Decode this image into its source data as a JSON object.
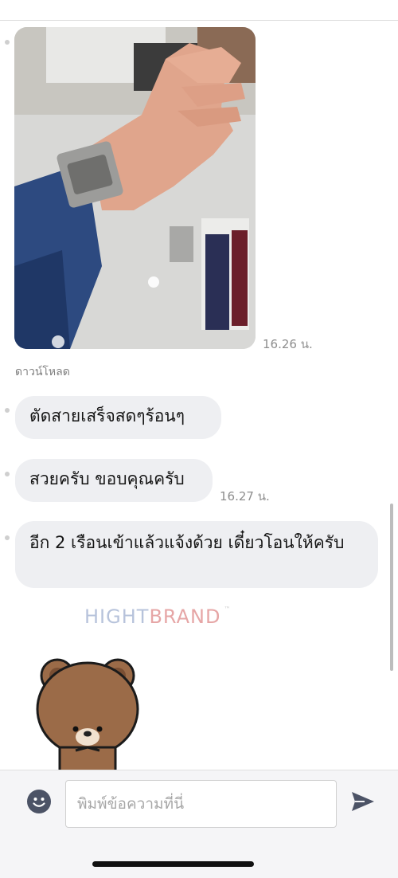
{
  "chat": {
    "photo": {
      "alt": "watch-photo"
    },
    "photo_time": "16.26 น.",
    "download_label": "ดาวน์โหลด",
    "messages": [
      {
        "text": "ตัดสายเสร็จสดๆร้อนๆ"
      },
      {
        "text": "สวยครับ ขอบคุณครับ",
        "time": "16.27 น."
      },
      {
        "text": "อีก 2 เรือนเข้าแล้วแจ้งด้วย เดี๋ยวโอนให้ครับ"
      }
    ],
    "sticker": {
      "brand_part1": "HIGHT",
      "brand_part2": "BRAND",
      "tm": "™"
    }
  },
  "composer": {
    "placeholder": "พิมพ์ข้อความที่นี่",
    "emoji_icon": "emoji-icon",
    "send_icon": "send-icon"
  },
  "colors": {
    "bubble": "#eeeff2",
    "accent": "#4c5366"
  }
}
